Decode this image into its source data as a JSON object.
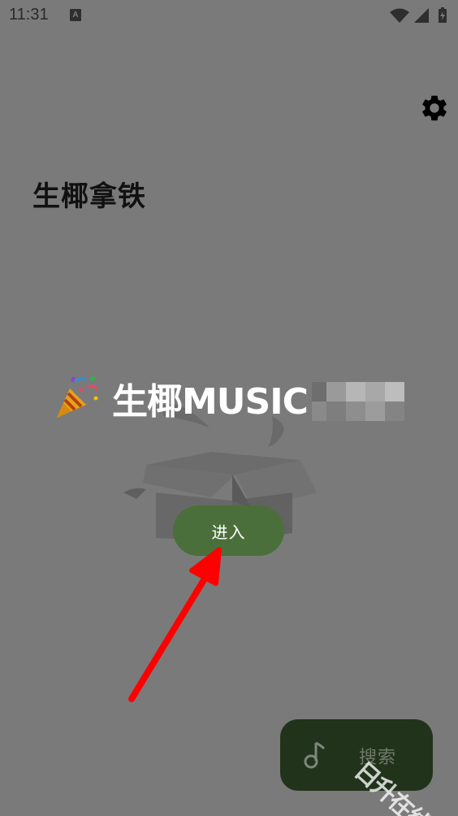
{
  "status_bar": {
    "time": "11:31",
    "notification_icon": "a-letter-icon",
    "icons": [
      "wifi-icon",
      "cellular-signal-icon",
      "battery-charging-icon"
    ]
  },
  "settings": {
    "icon": "gear-icon"
  },
  "app_title": "生椰拿铁",
  "banner": {
    "icon": "party-popper-icon",
    "text": "生椰MUSIC"
  },
  "enter_button": {
    "label": "进入"
  },
  "search_fab": {
    "icon": "music-note-icon",
    "label": "搜索"
  },
  "watermark": "日升在线",
  "colors": {
    "background": "#7a7a7a",
    "enter_button": "#4b6f3a",
    "search_fab": "#22331c",
    "arrow": "#ff0000"
  }
}
